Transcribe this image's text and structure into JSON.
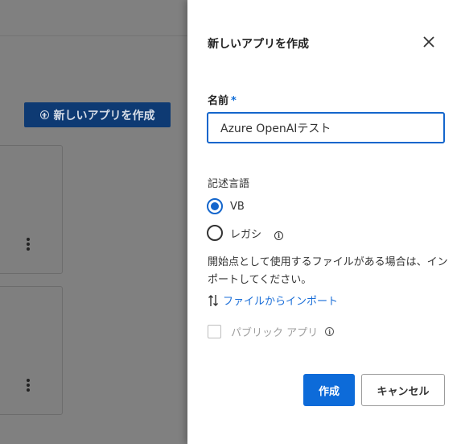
{
  "background": {
    "new_app_button_label": "新しいアプリを作成",
    "cards": [
      {
        "menu_icon": "kebab-icon"
      },
      {
        "menu_icon": "kebab-icon"
      }
    ]
  },
  "panel": {
    "title": "新しいアプリを作成",
    "close_icon": "close-icon",
    "name_field": {
      "label": "名前",
      "required_marker": "*",
      "value": "Azure OpenAIテスト"
    },
    "language": {
      "label": "記述言語",
      "options": [
        {
          "label": "VB",
          "selected": true
        },
        {
          "label": "レガシ",
          "selected": false,
          "has_info_icon": true
        }
      ]
    },
    "import_help_text": "開始点として使用するファイルがある場合は、インポートしてください。",
    "import_link_label": "ファイルからインポート",
    "public_app": {
      "label": "パブリック アプリ",
      "checked": false,
      "disabled": true
    },
    "buttons": {
      "create_label": "作成",
      "cancel_label": "キャンセル"
    }
  },
  "colors": {
    "accent": "#0d6bd9",
    "link": "#1a6ed8",
    "backdrop": "#808080"
  }
}
